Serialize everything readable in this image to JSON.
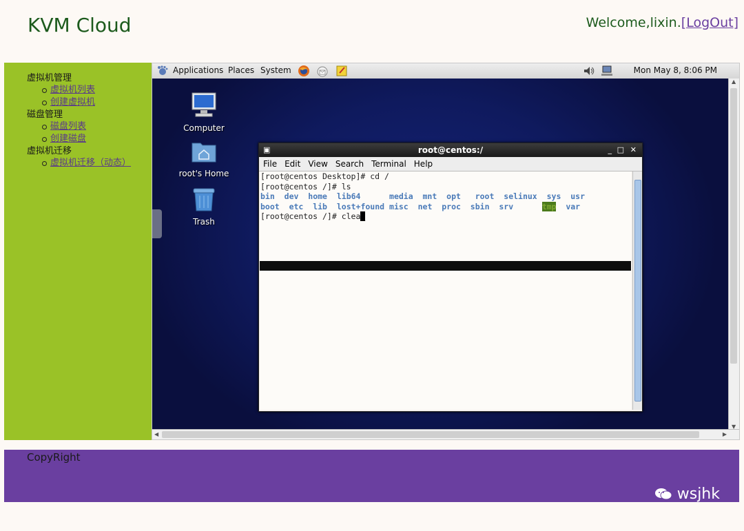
{
  "header": {
    "site_title": "KVM Cloud",
    "welcome_text": "Welcome,lixin.",
    "logout_label": "[LogOut]"
  },
  "sidebar": {
    "groups": [
      {
        "label": "虚拟机管理",
        "items": [
          {
            "label": "虚拟机列表"
          },
          {
            "label": "创建虚拟机"
          }
        ]
      },
      {
        "label": "磁盘管理",
        "items": [
          {
            "label": "磁盘列表"
          },
          {
            "label": "创建磁盘"
          }
        ]
      },
      {
        "label": "虚拟机迁移",
        "items": [
          {
            "label": "虚拟机迁移（动态）"
          }
        ]
      }
    ]
  },
  "vm": {
    "panel": {
      "applications": "Applications",
      "places": "Places",
      "system": "System",
      "clock": "Mon May  8,  8:06 PM"
    },
    "desktop_icons": [
      {
        "label": "Computer",
        "icon": "computer-icon"
      },
      {
        "label": "root's Home",
        "icon": "home-folder-icon"
      },
      {
        "label": "Trash",
        "icon": "trash-icon"
      }
    ],
    "terminal": {
      "title": "root@centos:/",
      "menu": [
        "File",
        "Edit",
        "View",
        "Search",
        "Terminal",
        "Help"
      ],
      "lines": {
        "l1": "[root@centos Desktop]# cd /",
        "l2": "[root@centos /]# ls",
        "row1": [
          "bin",
          "dev",
          "home",
          "lib64",
          "media",
          "mnt",
          "opt",
          "root",
          "selinux",
          "sys",
          "usr"
        ],
        "row2": [
          "boot",
          "etc",
          "lib",
          "lost+found",
          "misc",
          "net",
          "proc",
          "sbin",
          "srv",
          "tmp",
          "var"
        ],
        "l5": "[root@centos /]# clea"
      }
    }
  },
  "footer": {
    "copyright": "CopyRight",
    "brand": "wsjhk"
  }
}
